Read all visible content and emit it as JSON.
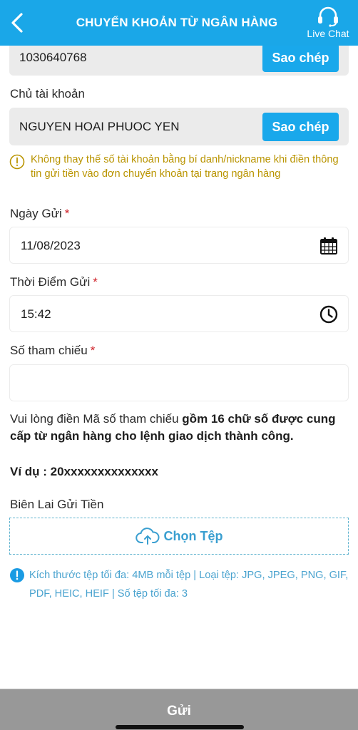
{
  "header": {
    "title": "CHUYỂN KHOẢN TỪ NGÂN HÀNG",
    "back_icon": "chevron-left-icon",
    "live_chat_label": "Live Chat",
    "live_chat_icon": "headset-icon"
  },
  "account": {
    "number": "1030640768",
    "copy_label": "Sao chép",
    "holder_label": "Chủ tài khoản",
    "holder_name": "NGUYEN HOAI PHUOC YEN",
    "holder_copy_label": "Sao chép"
  },
  "warning": {
    "icon": "exclamation-circle-icon",
    "text": "Không thay thế số tài khoản bằng bí danh/nickname khi điền thông tin gửi tiền vào đơn chuyển khoản tại trang ngân hàng"
  },
  "form": {
    "date": {
      "label": "Ngày Gửi",
      "required_mark": "*",
      "value": "11/08/2023",
      "icon": "calendar-icon"
    },
    "time": {
      "label": "Thời Điểm Gửi",
      "required_mark": "*",
      "value": "15:42",
      "icon": "clock-icon"
    },
    "reference": {
      "label": "Số tham chiếu",
      "required_mark": "*",
      "value": "",
      "placeholder": ""
    }
  },
  "note": {
    "prefix": "Vui lòng điền Mã số tham chiếu ",
    "bold": "gồm 16 chữ số được cung cấp từ ngân hàng cho lệnh giao dịch thành công.",
    "example": "Ví dụ : 20xxxxxxxxxxxxxx"
  },
  "receipt": {
    "label": "Biên Lai Gửi Tiền",
    "upload_label": "Chọn Tệp",
    "upload_icon": "cloud-upload-icon"
  },
  "file_info": {
    "icon": "info-circle-icon",
    "text": "Kích thước tệp tối đa: 4MB mỗi tệp | Loại tệp: JPG, JPEG, PNG, GIF, PDF, HEIC, HEIF | Số tệp tối đa: 3"
  },
  "footer": {
    "submit_label": "Gửi"
  },
  "colors": {
    "primary": "#1aa7e8",
    "warning": "#b99400",
    "info": "#4aa3cf",
    "required": "#d0242b",
    "disabled_button": "#989898"
  }
}
